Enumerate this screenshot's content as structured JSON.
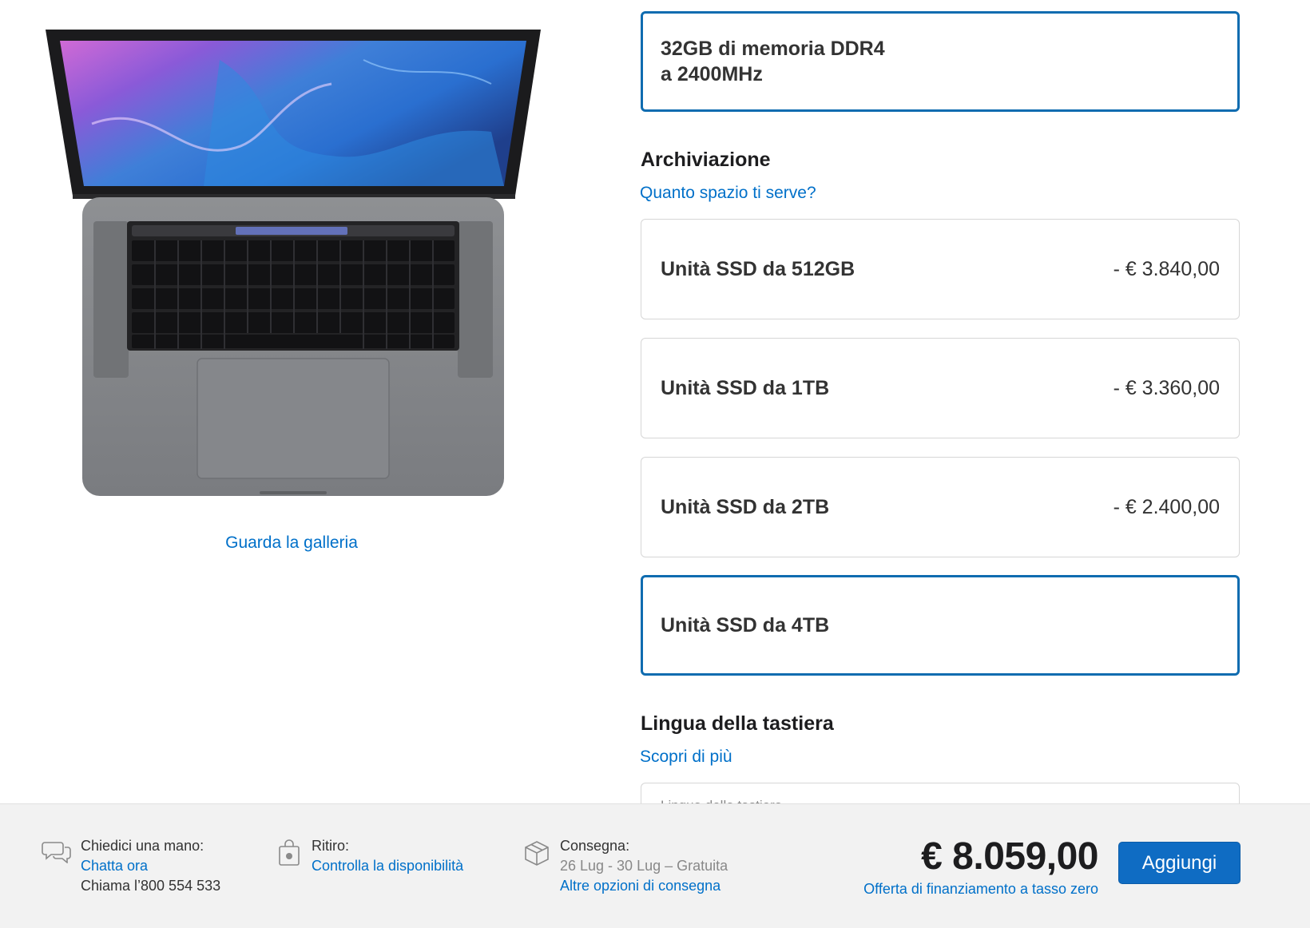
{
  "gallery": {
    "link_label": "Guarda la galleria"
  },
  "memory": {
    "selected_line1": "32GB di memoria DDR4",
    "selected_line2": "a 2400MHz"
  },
  "storage": {
    "title": "Archiviazione",
    "help_link": "Quanto spazio ti serve?",
    "options": [
      {
        "label": "Unità SSD da 512GB",
        "price": "- € 3.840,00",
        "selected": false
      },
      {
        "label": "Unità SSD da 1TB",
        "price": "- € 3.360,00",
        "selected": false
      },
      {
        "label": "Unità SSD da 2TB",
        "price": "- € 2.400,00",
        "selected": false
      },
      {
        "label": "Unità SSD da 4TB",
        "price": "",
        "selected": true
      }
    ]
  },
  "keyboard_language": {
    "title": "Lingua della tastiera",
    "link": "Scopri di più",
    "select_label": "Lingua della tastiera"
  },
  "footer": {
    "help": {
      "title": "Chiedici una mano:",
      "chat_link": "Chatta ora",
      "phone": "Chiama l’800 554 533"
    },
    "pickup": {
      "title": "Ritiro:",
      "link": "Controlla la disponibilità"
    },
    "delivery": {
      "title": "Consegna:",
      "dates": "26 Lug - 30 Lug – Gratuita",
      "link": "Altre opzioni di consegna"
    },
    "total": "€ 8.059,00",
    "finance_link": "Offerta di finanziamento a tasso zero",
    "add_button": "Aggiungi"
  },
  "colors": {
    "accent": "#0070c9",
    "selected_border": "#0f6cb0",
    "button": "#0f6cc3",
    "footer_bg": "#f2f2f2"
  }
}
